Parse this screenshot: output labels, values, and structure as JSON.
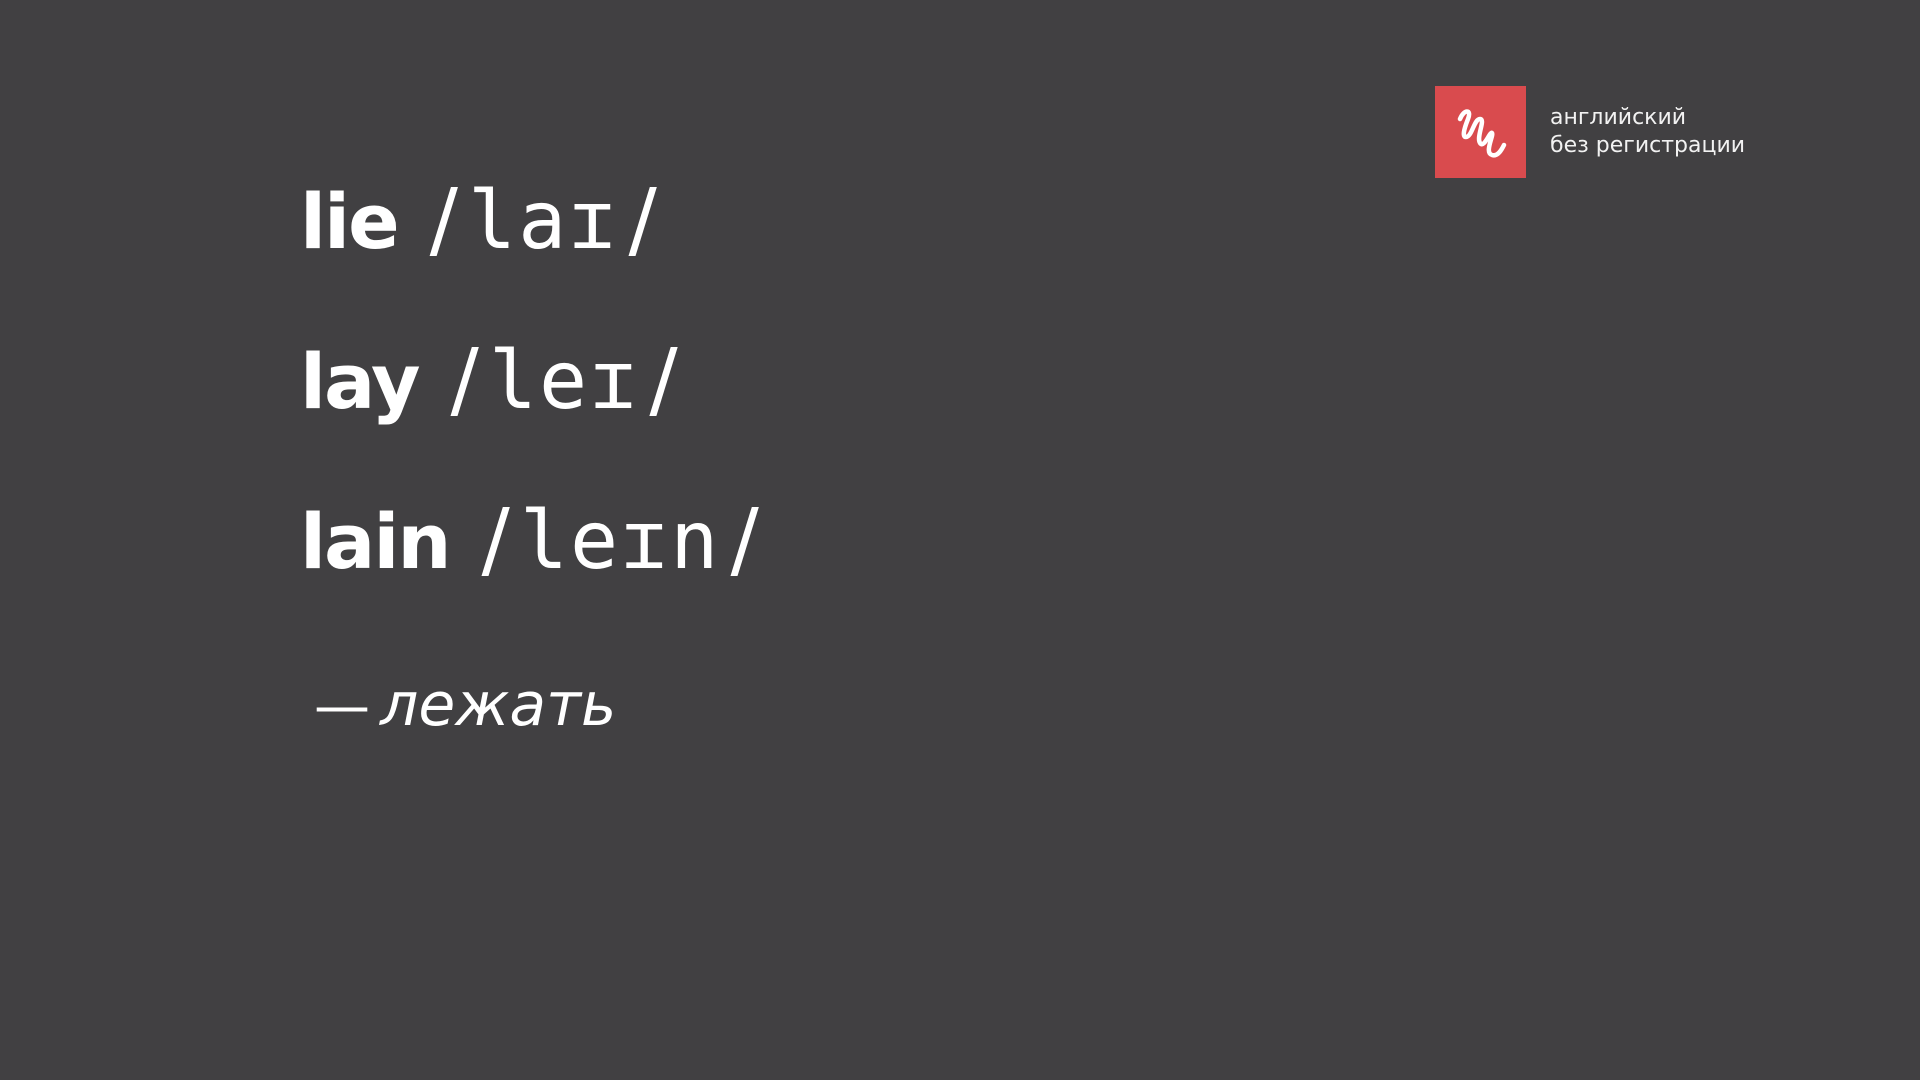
{
  "brand": {
    "line1": "английский",
    "line2": "без регистрации",
    "accent_color": "#d94b4e",
    "icon": "scribble-logo-icon"
  },
  "words": [
    {
      "word": "lie",
      "open_slash": "/",
      "ipa": "laɪ",
      "close_slash": "/"
    },
    {
      "word": "lay",
      "open_slash": "/",
      "ipa": "leɪ",
      "close_slash": "/"
    },
    {
      "word": "lain",
      "open_slash": "/",
      "ipa": "leɪn",
      "close_slash": "/"
    }
  ],
  "translation": {
    "dash": "—",
    "meaning": "лежать"
  },
  "colors": {
    "background": "#414042",
    "text": "#ffffff"
  }
}
